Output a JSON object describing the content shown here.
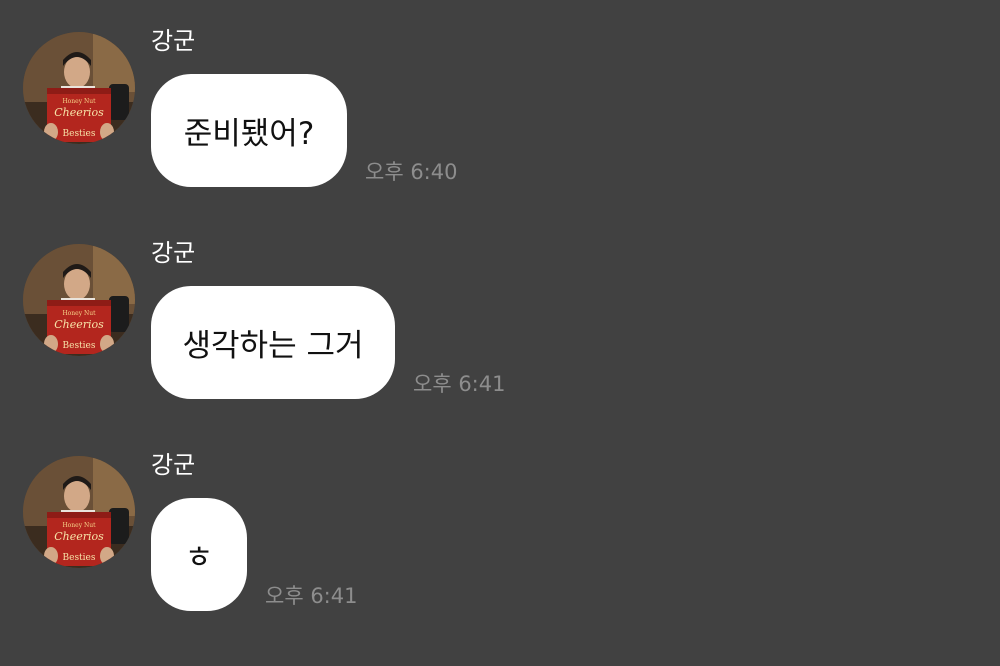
{
  "messages": [
    {
      "sender": "강군",
      "text": "준비됐어?",
      "time": "오후 6:40"
    },
    {
      "sender": "강군",
      "text": "생각하는 그거",
      "time": "오후 6:41"
    },
    {
      "sender": "강군",
      "text": "ㅎ",
      "time": "오후 6:41"
    }
  ],
  "avatar": {
    "icon": "profile-photo-cereal-box",
    "box_lines": [
      "Honey Nut",
      "Cheerios",
      "Besties"
    ]
  },
  "colors": {
    "background": "#414141",
    "bubble": "#ffffff",
    "sender_text": "#ffffff",
    "time_text": "#8d8d8d",
    "cereal_box": "#b3261e"
  }
}
